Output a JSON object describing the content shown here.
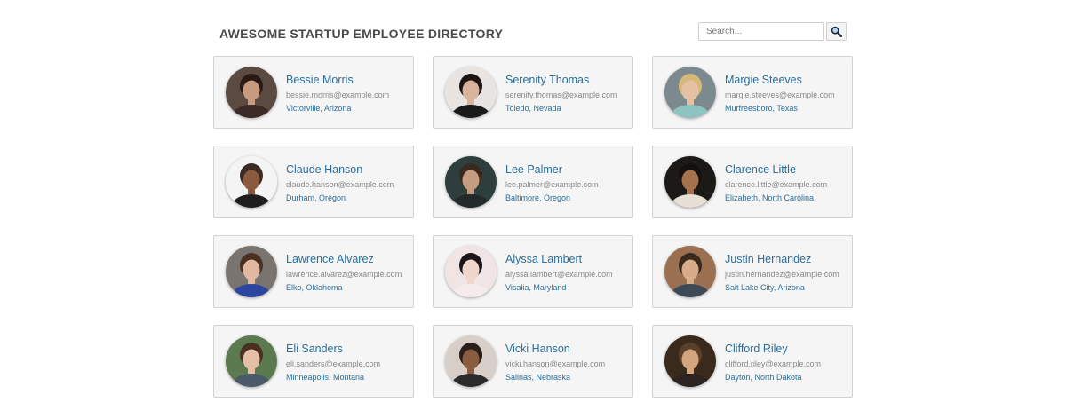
{
  "header": {
    "title": "AWESOME STARTUP EMPLOYEE DIRECTORY"
  },
  "search": {
    "placeholder": "Search...",
    "value": "",
    "icon": "magnifier-icon"
  },
  "employees": [
    {
      "name": "Bessie Morris",
      "email": "bessie.morris@example.com",
      "location": "Victorville, Arizona",
      "bg": "#5b4a40",
      "skin": "#c89a80",
      "hair": "#2a1a14",
      "shirt": "#3b2a25"
    },
    {
      "name": "Serenity Thomas",
      "email": "serenity.thomas@example.com",
      "location": "Toledo, Nevada",
      "bg": "#e8e4e2",
      "skin": "#d8b49c",
      "hair": "#1e1512",
      "shirt": "#1a1a1a"
    },
    {
      "name": "Margie Steeves",
      "email": "margie.steeves@example.com",
      "location": "Murfreesboro, Texas",
      "bg": "#7c8a90",
      "skin": "#e4c0a4",
      "hair": "#d8b878",
      "shirt": "#8ec4c0"
    },
    {
      "name": "Claude Hanson",
      "email": "claude.hanson@example.com",
      "location": "Durham, Oregon",
      "bg": "#f4f4f4",
      "skin": "#8a5a3e",
      "hair": "#3a2a22",
      "shirt": "#1e1e1e"
    },
    {
      "name": "Lee Palmer",
      "email": "lee.palmer@example.com",
      "location": "Baltimore, Oregon",
      "bg": "#2e3e3c",
      "skin": "#c49c82",
      "hair": "#3a2a1e",
      "shirt": "#232b2a"
    },
    {
      "name": "Clarence Little",
      "email": "clarence.little@example.com",
      "location": "Elizabeth, North Carolina",
      "bg": "#1c1a16",
      "skin": "#a6724e",
      "hair": "#141010",
      "shirt": "#e6e0d6"
    },
    {
      "name": "Lawrence Alvarez",
      "email": "lawrence.alvarez@example.com",
      "location": "Elko, Oklahoma",
      "bg": "#7a7470",
      "skin": "#e2b8a0",
      "hair": "#4a3020",
      "shirt": "#2c46a0"
    },
    {
      "name": "Alyssa Lambert",
      "email": "alyssa.lambert@example.com",
      "location": "Visalia, Maryland",
      "bg": "#f0e4e4",
      "skin": "#efd6cc",
      "hair": "#1c1618",
      "shirt": "#f4ecec"
    },
    {
      "name": "Justin Hernandez",
      "email": "justin.hernandez@example.com",
      "location": "Salt Lake City, Arizona",
      "bg": "#9a7050",
      "skin": "#d8ac8a",
      "hair": "#3a2a1e",
      "shirt": "#3c4a58"
    },
    {
      "name": "Eli Sanders",
      "email": "eli.sanders@example.com",
      "location": "Minneapolis, Montana",
      "bg": "#5c7a50",
      "skin": "#e6c0a6",
      "hair": "#4a3020",
      "shirt": "#4a5a68"
    },
    {
      "name": "Vicki Hanson",
      "email": "vicki.hanson@example.com",
      "location": "Salinas, Nebraska",
      "bg": "#d8d0c8",
      "skin": "#8a5c40",
      "hair": "#2a1e18",
      "shirt": "#2a2a2a"
    },
    {
      "name": "Clifford Riley",
      "email": "clifford.riley@example.com",
      "location": "Dayton, North Dakota",
      "bg": "#3a2a1c",
      "skin": "#d4a680",
      "hair": "#5a4028",
      "shirt": "#2c2420"
    }
  ]
}
